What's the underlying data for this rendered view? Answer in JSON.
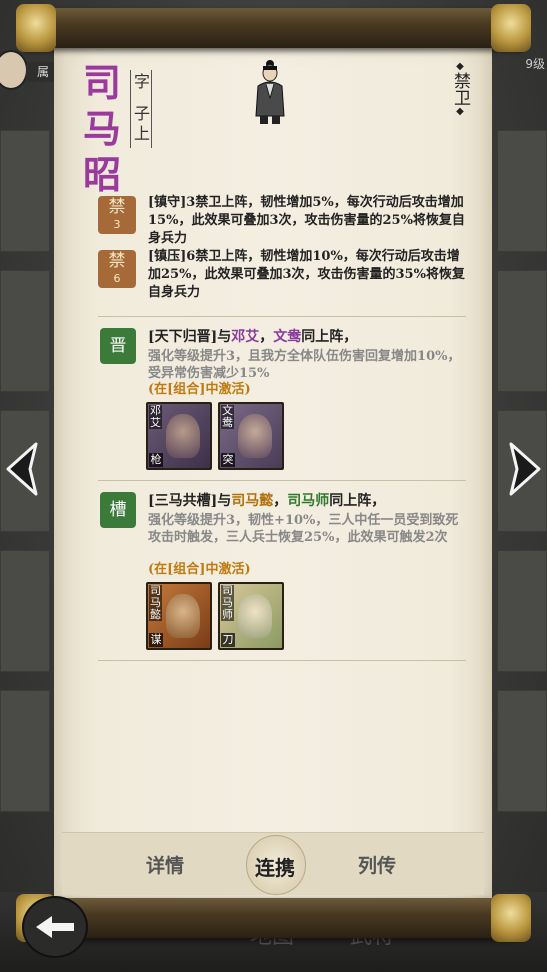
{
  "header": {
    "hero_name": "司马昭",
    "courtesy_label": "字",
    "courtesy_name": "子上",
    "unit_class": "禁卫"
  },
  "background": {
    "badge_text": "属",
    "level_text": "9级",
    "bottom_nav": [
      "",
      "",
      "地图",
      "武将",
      ""
    ]
  },
  "abilities": [
    {
      "tag": "禁",
      "tag_num": "3",
      "text": "[镇守]3禁卫上阵，韧性增加5%，每次行动后攻击增加15%，此效果可叠加3次，攻击伤害量的25%将恢复自身兵力"
    },
    {
      "tag": "禁",
      "tag_num": "6",
      "text": "[镇压]6禁卫上阵，韧性增加10%，每次行动后攻击增加25%，此效果可叠加3次，攻击伤害量的35%将恢复自身兵力"
    }
  ],
  "combos": [
    {
      "tag": "晋",
      "title_prefix": "[天下归晋]与",
      "partner1": "邓艾",
      "sep": "，",
      "partner2": "文鸯",
      "title_suffix": "同上阵，",
      "desc": "强化等级提升3，且我方全体队伍伤害回复增加10%，受异常伤害减少15%",
      "activate": "(在[组合]中激活)",
      "cards": [
        {
          "name": "邓艾",
          "type": "枪"
        },
        {
          "name": "文鸯",
          "type": "突"
        }
      ]
    },
    {
      "tag": "槽",
      "title_prefix": "[三马共槽]与",
      "partner1": "司马懿",
      "sep": "，",
      "partner2": "司马师",
      "title_suffix": "同上阵，",
      "desc": "强化等级提升3，韧性+10%，三人中任一员受到致死攻击时触发，三人兵士恢复25%，此效果可触发2次",
      "activate": "(在[组合]中激活)",
      "cards": [
        {
          "name": "司马懿",
          "type": "谋"
        },
        {
          "name": "司马师",
          "type": "刀"
        }
      ]
    }
  ],
  "tabs": {
    "details": "详情",
    "combo": "连携",
    "biography": "列传"
  },
  "colors": {
    "name_purple": "#9a3a9c",
    "ability_tag": "#a56a37",
    "combo_tag": "#3c7a3a",
    "activate_orange": "#c07a10"
  }
}
